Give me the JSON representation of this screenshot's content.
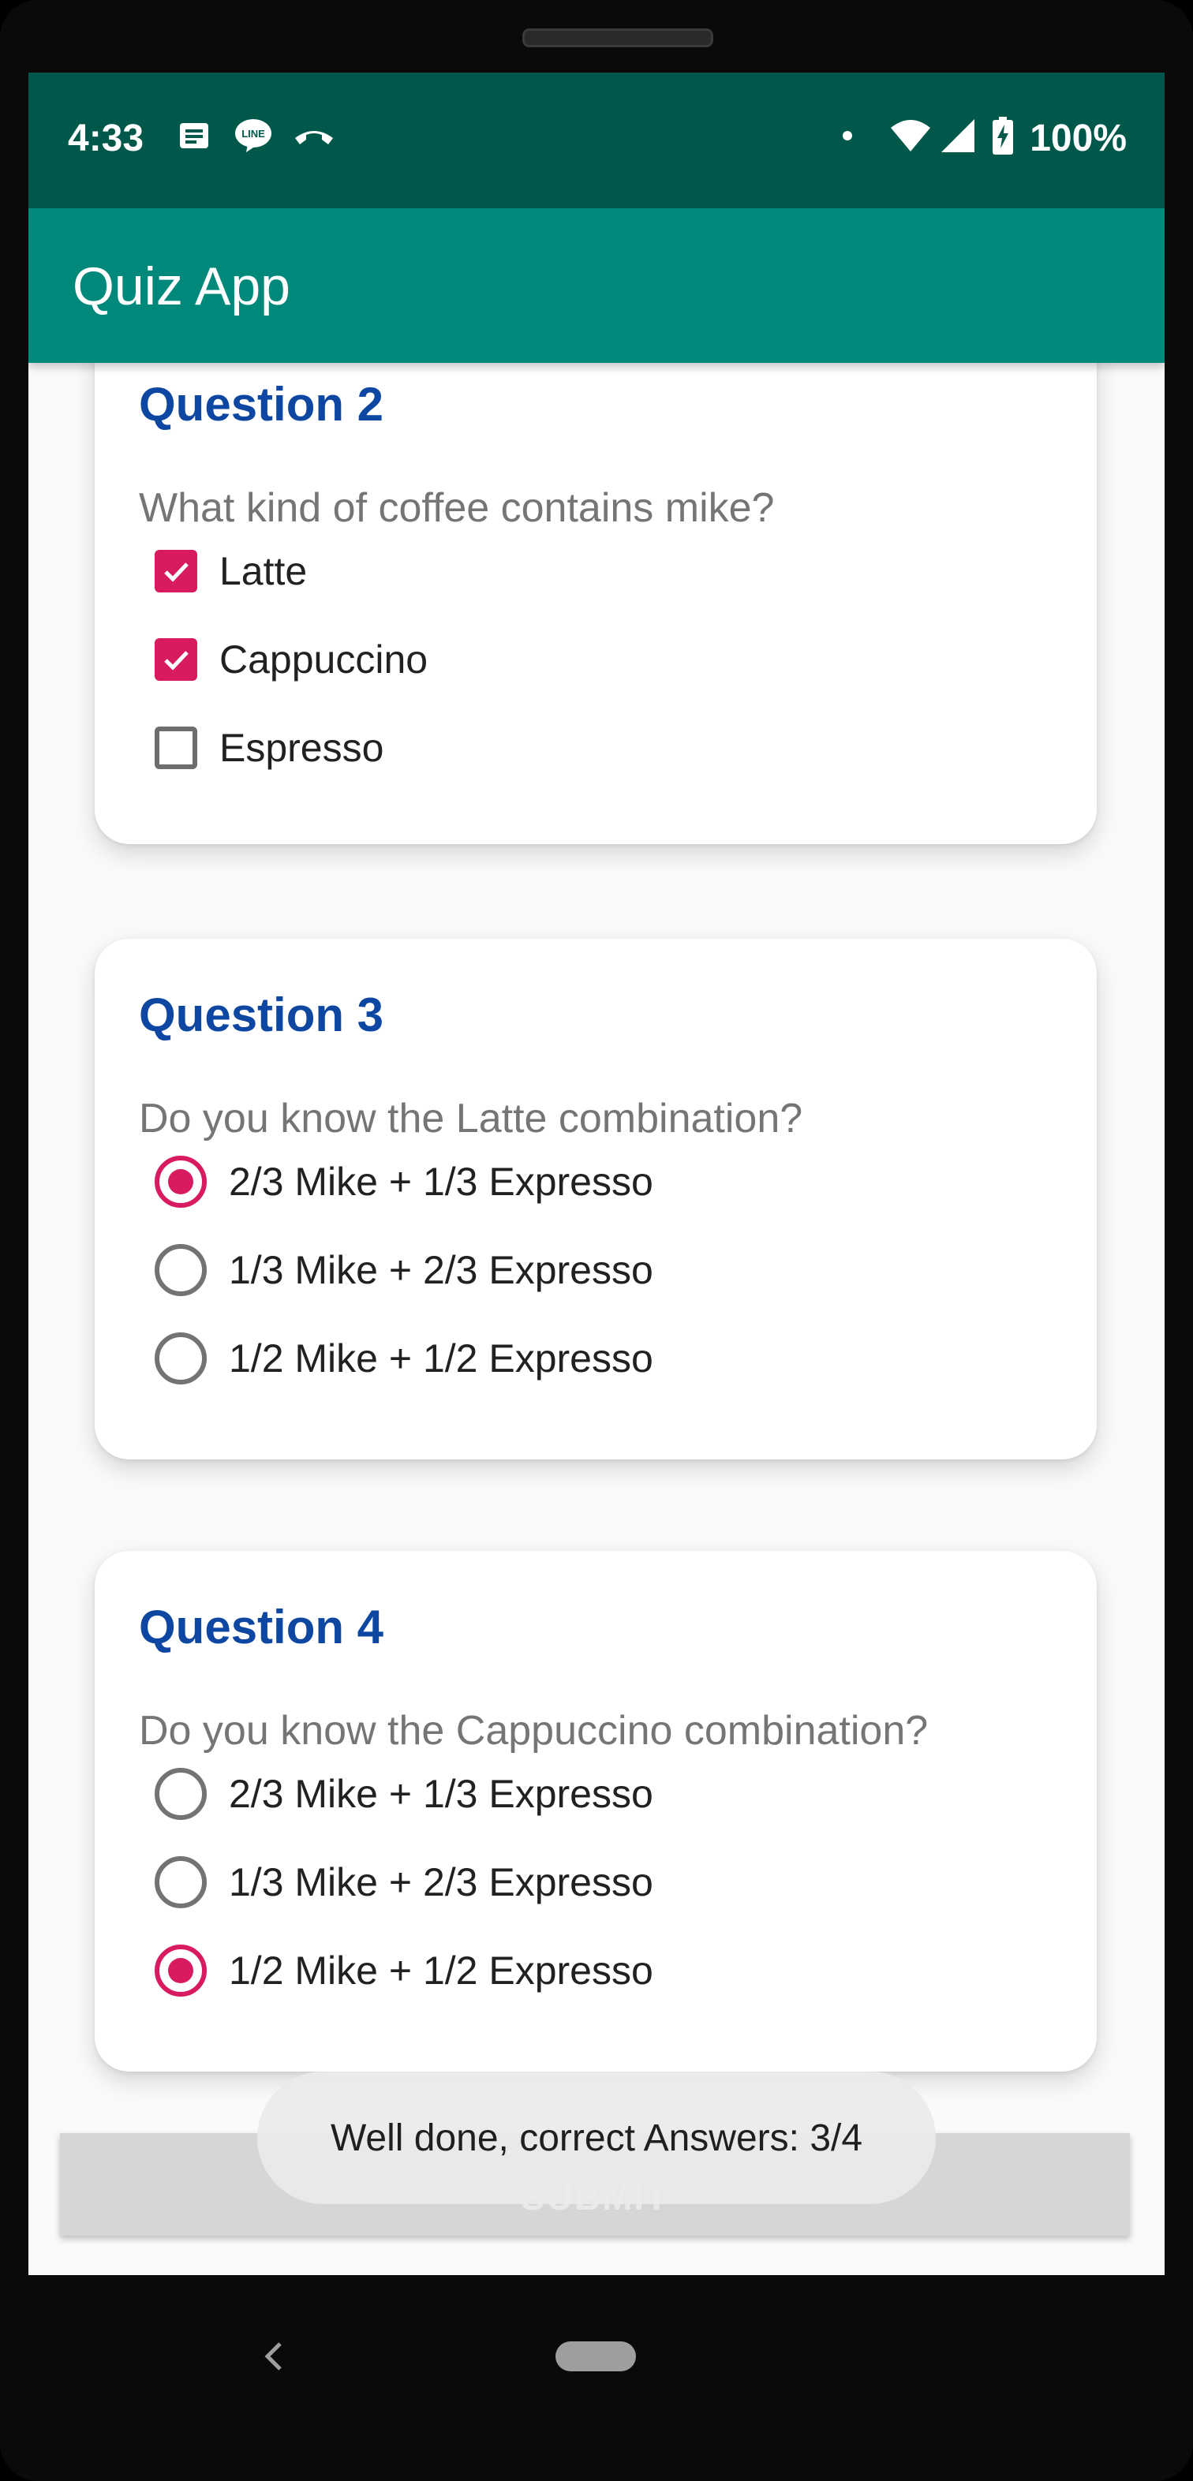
{
  "status_bar": {
    "time": "4:33",
    "left_icons": [
      "message-icon",
      "line-app-icon",
      "call-icon"
    ],
    "right_icons": [
      "dot-icon",
      "wifi-icon",
      "signal-icon",
      "battery-charging-icon"
    ],
    "battery": "100%"
  },
  "app_bar": {
    "title": "Quiz App"
  },
  "questions": [
    {
      "title": "Question 2",
      "text": "What kind of coffee contains mike?",
      "type": "checkbox",
      "options": [
        {
          "label": "Latte",
          "checked": true
        },
        {
          "label": "Cappuccino",
          "checked": true
        },
        {
          "label": "Espresso",
          "checked": false
        }
      ]
    },
    {
      "title": "Question 3",
      "text": "Do you know the Latte combination?",
      "type": "radio",
      "options": [
        {
          "label": "2/3 Mike + 1/3 Expresso",
          "checked": true
        },
        {
          "label": "1/3 Mike + 2/3 Expresso",
          "checked": false
        },
        {
          "label": "1/2 Mike + 1/2 Expresso",
          "checked": false
        }
      ]
    },
    {
      "title": "Question 4",
      "text": "Do you know the Cappuccino combination?",
      "type": "radio",
      "options": [
        {
          "label": "2/3 Mike + 1/3 Expresso",
          "checked": false
        },
        {
          "label": "1/3 Mike + 2/3 Expresso",
          "checked": false
        },
        {
          "label": "1/2 Mike + 1/2 Expresso",
          "checked": true
        }
      ]
    }
  ],
  "submit_button": {
    "label": "SUBMIT",
    "enabled": false
  },
  "toast": {
    "message": "Well done, correct Answers: 3/4"
  },
  "colors": {
    "status_bar": "#00584b",
    "app_bar": "#00897b",
    "accent": "#d81b60",
    "question_title": "#0d47a1"
  }
}
